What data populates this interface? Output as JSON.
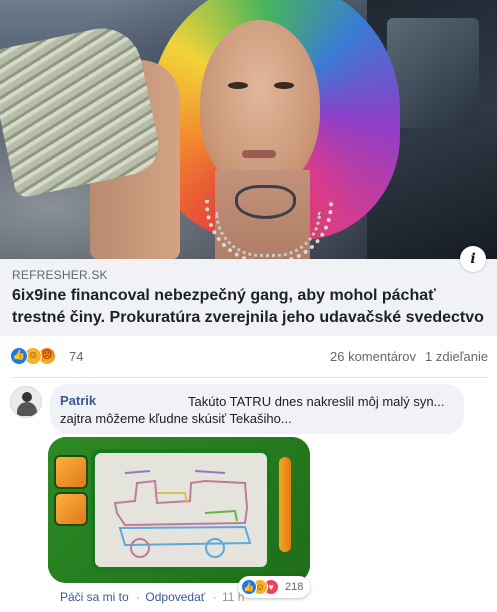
{
  "link_preview": {
    "domain": "REFRESHER.SK",
    "headline": "6ix9ine financoval nebezpečný gang, aby mohol páchať trestné činy. Prokuratúra zverejnila jeho udavačské svedectvo",
    "info_icon": "i"
  },
  "reactions": {
    "icons": [
      "like-icon",
      "haha-icon",
      "angry-icon"
    ],
    "count": "74",
    "comments": "26 komentárov",
    "shares": "1 zdieľanie"
  },
  "comment": {
    "author": "Patrik",
    "text": "Takúto TATRU dnes nakreslil môj malý syn... zajtra môžeme kľudne skúsiť Tekašiho...",
    "attachment_reactions": {
      "icons": [
        "like-icon",
        "haha-icon",
        "love-icon"
      ],
      "count": "218"
    },
    "actions": {
      "like": "Páči sa mi to",
      "reply": "Odpovedať",
      "time": "11 h"
    }
  },
  "colors": {
    "link_blue": "#385898",
    "meta_gray": "#606770",
    "card_bg": "#f0f2f5",
    "like_blue": "#1877f2"
  }
}
